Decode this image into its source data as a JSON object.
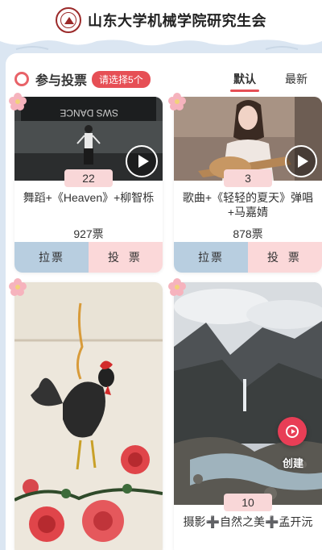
{
  "header": {
    "title": "山东大学机械学院研究生会",
    "logo_icon": "university-seal-logo"
  },
  "vote_section": {
    "title": "参与投票",
    "hint": "请选择5个",
    "tabs": [
      {
        "label": "默认",
        "active": true
      },
      {
        "label": "最新",
        "active": false
      }
    ]
  },
  "cards": [
    {
      "number": "22",
      "title": "舞蹈+《Heaven》+柳智栎",
      "votes": "927票",
      "canvass_label": "拉票",
      "vote_label": "投 票",
      "has_video": true
    },
    {
      "number": "3",
      "title": "歌曲+《轻轻的夏天》弹唱+马嘉婧",
      "votes": "878票",
      "canvass_label": "拉票",
      "vote_label": "投 票",
      "has_video": true
    },
    {
      "number": "",
      "title": "",
      "votes": "",
      "has_video": false
    },
    {
      "number": "10",
      "title": "摄影➕自然之美➕孟开沅",
      "votes": "",
      "has_video": false
    }
  ],
  "fab": {
    "label": "创建",
    "icon": "play-circle-icon"
  },
  "colors": {
    "accent": "#e64f55",
    "canvass_bg": "#b8cee0",
    "vote_bg": "#fbd8d9",
    "page_bg": "#dbe6f2"
  }
}
